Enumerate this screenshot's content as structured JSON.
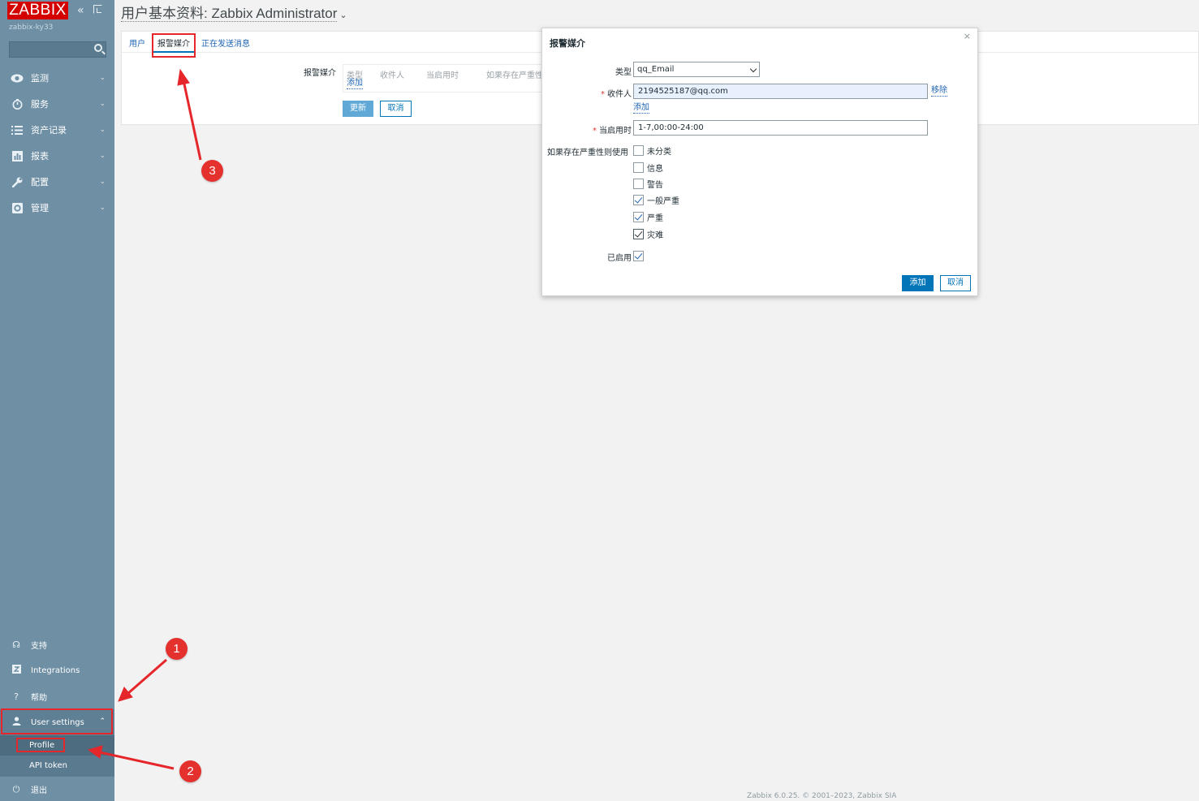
{
  "sidebar": {
    "logo": "ZABBIX",
    "server_name": "zabbix-ky33",
    "menu": [
      {
        "label": "监测",
        "icon": "eye-icon"
      },
      {
        "label": "服务",
        "icon": "clock-icon"
      },
      {
        "label": "资产记录",
        "icon": "list-icon"
      },
      {
        "label": "报表",
        "icon": "bar-chart-icon"
      },
      {
        "label": "配置",
        "icon": "wrench-icon"
      },
      {
        "label": "管理",
        "icon": "gear-icon"
      }
    ],
    "bottom": {
      "support": "支持",
      "integrations": "Integrations",
      "help": "帮助",
      "user_settings": "User settings",
      "profile": "Profile",
      "api_token": "API token",
      "logout": "退出"
    }
  },
  "header": {
    "title": "用户基本资料: Zabbix Administrator"
  },
  "main": {
    "tabs": [
      "用户",
      "报警媒介",
      "正在发送消息"
    ],
    "media_label": "报警媒介",
    "columns": [
      "类型",
      "收件人",
      "当启用时",
      "如果存在严重性"
    ],
    "add_link": "添加",
    "update_button": "更新",
    "cancel_button": "取消"
  },
  "modal": {
    "title": "报警媒介",
    "close": "×",
    "type_label": "类型",
    "type_value": "qq_Email",
    "recipient_label": "收件人",
    "recipient_value": "2194525187@qq.com",
    "remove_link": "移除",
    "add_link": "添加",
    "when_active_label": "当启用时",
    "when_active_value": "1-7,00:00-24:00",
    "severity_label": "如果存在严重性则使用",
    "severities": [
      {
        "label": "未分类",
        "checked": false
      },
      {
        "label": "信息",
        "checked": false
      },
      {
        "label": "警告",
        "checked": false
      },
      {
        "label": "一般严重",
        "checked": true
      },
      {
        "label": "严重",
        "checked": true
      },
      {
        "label": "灾难",
        "checked": true
      }
    ],
    "enabled_label": "已启用",
    "enabled": true,
    "add_button": "添加",
    "cancel_button": "取消"
  },
  "annotations": [
    "1",
    "2",
    "3"
  ],
  "footer": "Zabbix 6.0.25. © 2001–2023, Zabbix SIA",
  "colors": {
    "sidebar": "#6e8fa4",
    "logo": "#d40000",
    "primary": "#0275b8",
    "annotation": "#e4312e"
  }
}
